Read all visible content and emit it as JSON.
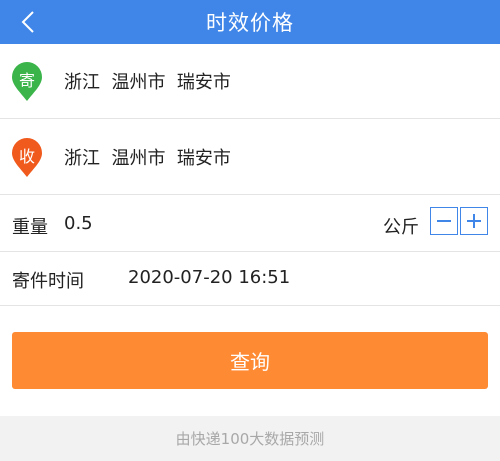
{
  "header": {
    "title": "时效价格",
    "back_icon": "chevron-left-icon",
    "background": "#3f86e8"
  },
  "sender": {
    "badge": "寄",
    "badge_color": "#3bb54a",
    "address": "浙江  温州市  瑞安市"
  },
  "receiver": {
    "badge": "收",
    "badge_color": "#f05a1c",
    "address": "浙江  温州市  瑞安市"
  },
  "weight": {
    "label": "重量",
    "value": "0.5",
    "unit": "公斤",
    "minus_icon": "minus-icon",
    "plus_icon": "plus-icon"
  },
  "send_time": {
    "label": "寄件时间",
    "value": "2020-07-20 16:51"
  },
  "query_button": {
    "label": "查询",
    "color": "#ff8a34"
  },
  "footer": {
    "text": "由快递100大数据预测"
  }
}
